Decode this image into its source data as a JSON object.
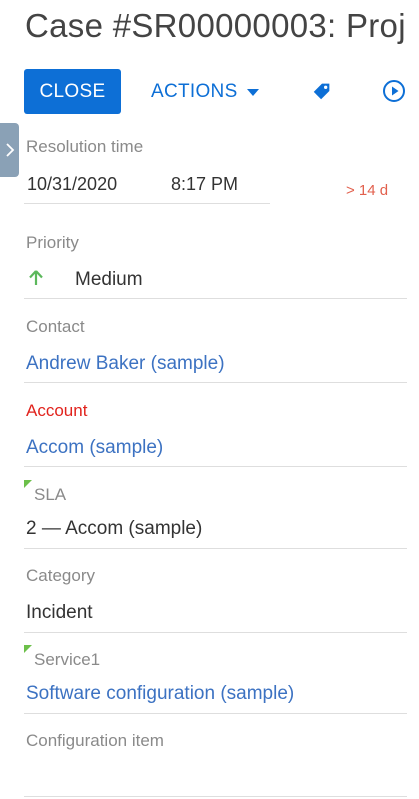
{
  "header": {
    "title": "Case #SR00000003: Proj",
    "close_label": "CLOSE",
    "actions_label": "ACTIONS"
  },
  "fields": {
    "resolution_time": {
      "label": "Resolution time",
      "date": "10/31/2020",
      "time": "8:17 PM",
      "overdue": "> 14 d"
    },
    "priority": {
      "label": "Priority",
      "value": "Medium"
    },
    "contact": {
      "label": "Contact",
      "value": "Andrew Baker (sample)"
    },
    "account": {
      "label": "Account",
      "value": "Accom (sample)"
    },
    "sla": {
      "label": "SLA",
      "value": "2 — Accom (sample)"
    },
    "category": {
      "label": "Category",
      "value": "Incident"
    },
    "service": {
      "label": "Service1",
      "value": "Software configuration (sample)"
    },
    "configuration_item": {
      "label": "Configuration item",
      "value": ""
    }
  },
  "icons": {
    "tag": "tag-icon",
    "play": "play-circle-icon",
    "priority": "arrow-up-icon",
    "sidebar": "chevron-right-icon"
  },
  "colors": {
    "primary": "#0d6fd6",
    "link": "#3c72c2",
    "required": "#e1231d",
    "overdue": "#e2604d",
    "priority_arrow": "#5cb85c",
    "sidebar_toggle": "#8aa1b6"
  }
}
